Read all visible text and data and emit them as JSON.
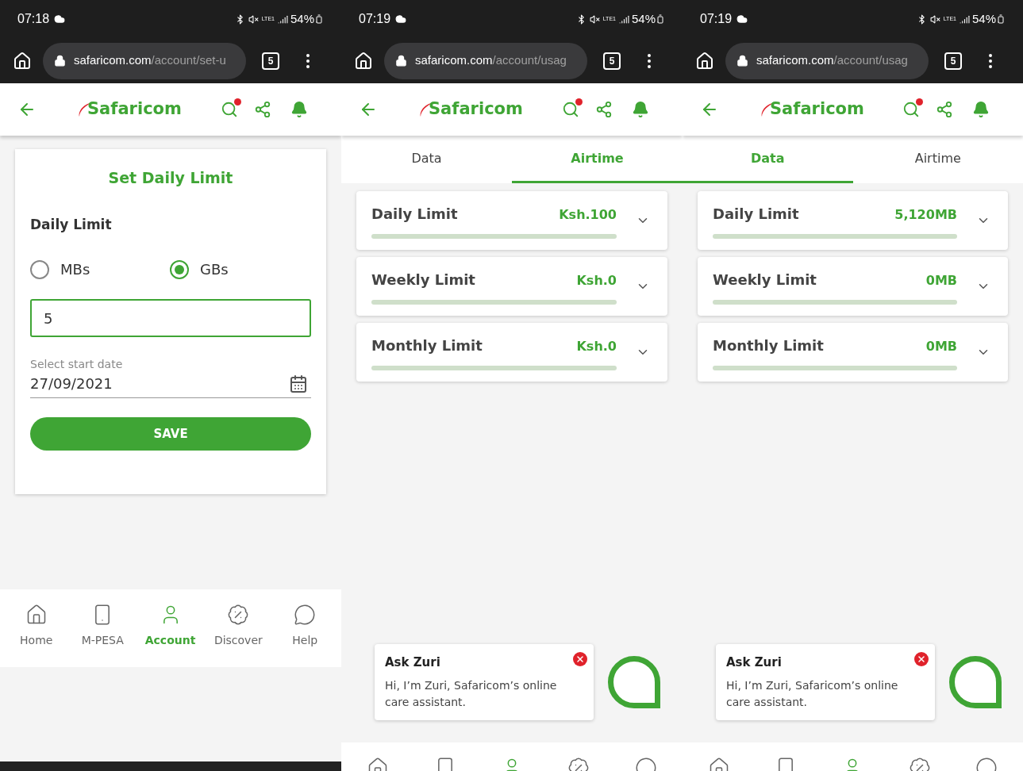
{
  "screens": [
    {
      "kind": "form",
      "status_bar": {
        "time": "07:18",
        "network": "LTE1",
        "battery": "54%"
      },
      "browser": {
        "url_host": "safaricom.com",
        "url_path": "/account/set-u",
        "tab_count": "5"
      },
      "app_header": {
        "logo": "Safaricom"
      },
      "form": {
        "title": "Set Daily Limit",
        "section": "Daily Limit",
        "units": [
          {
            "label": "MBs",
            "selected": false
          },
          {
            "label": "GBs",
            "selected": true
          }
        ],
        "amount": "5",
        "date_label": "Select start date",
        "date_value": "27/09/2021",
        "save": "SAVE"
      },
      "bottom_nav": [
        {
          "label": "Home",
          "selected": false
        },
        {
          "label": "M-PESA",
          "selected": false
        },
        {
          "label": "Account",
          "selected": true
        },
        {
          "label": "Discover",
          "selected": false
        },
        {
          "label": "Help",
          "selected": false
        }
      ]
    },
    {
      "kind": "usage",
      "status_bar": {
        "time": "07:19",
        "network": "LTE1",
        "battery": "54%"
      },
      "browser": {
        "url_host": "safaricom.com",
        "url_path": "/account/usag",
        "tab_count": "5"
      },
      "app_header": {
        "logo": "Safaricom"
      },
      "tabs": [
        {
          "label": "Data",
          "selected": false
        },
        {
          "label": "Airtime",
          "selected": true
        }
      ],
      "limits": [
        {
          "name": "Daily Limit",
          "value": "Ksh.100",
          "level": 0
        },
        {
          "name": "Weekly Limit",
          "value": "Ksh.0",
          "level": 0
        },
        {
          "name": "Monthly Limit",
          "value": "Ksh.0",
          "level": 0
        }
      ],
      "chat": {
        "title": "Ask Zuri",
        "message": "Hi, I’m Zuri, Safaricom’s online care assistant."
      },
      "bottom_nav": [
        {
          "selected": false
        },
        {
          "selected": false
        },
        {
          "selected": true
        },
        {
          "selected": false
        },
        {
          "selected": false
        }
      ]
    },
    {
      "kind": "usage",
      "status_bar": {
        "time": "07:19",
        "network": "LTE1",
        "battery": "54%"
      },
      "browser": {
        "url_host": "safaricom.com",
        "url_path": "/account/usag",
        "tab_count": "5"
      },
      "app_header": {
        "logo": "Safaricom"
      },
      "tabs": [
        {
          "label": "Data",
          "selected": true
        },
        {
          "label": "Airtime",
          "selected": false
        }
      ],
      "limits": [
        {
          "name": "Daily Limit",
          "value": "5,120MB",
          "level": 0
        },
        {
          "name": "Weekly Limit",
          "value": "0MB",
          "level": 0
        },
        {
          "name": "Monthly Limit",
          "value": "0MB",
          "level": 0
        }
      ],
      "chat": {
        "title": "Ask Zuri",
        "message": "Hi, I’m Zuri, Safaricom’s online care assistant."
      },
      "bottom_nav": [
        {
          "selected": false
        },
        {
          "selected": false
        },
        {
          "selected": true
        },
        {
          "selected": false
        },
        {
          "selected": false
        }
      ]
    }
  ]
}
